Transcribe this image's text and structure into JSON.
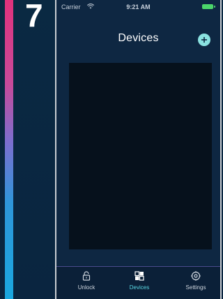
{
  "step": {
    "number": "7"
  },
  "status_bar": {
    "carrier": "Carrier",
    "time": "9:21 AM",
    "wifi_icon": "wifi-icon",
    "battery_icon": "battery-icon"
  },
  "nav": {
    "title": "Devices",
    "add_icon": "plus-icon"
  },
  "tabs": [
    {
      "label": "Unlock",
      "icon": "lock-icon",
      "active": false
    },
    {
      "label": "Devices",
      "icon": "grid-icon",
      "active": true
    },
    {
      "label": "Settings",
      "icon": "gear-icon",
      "active": false
    }
  ],
  "colors": {
    "accent_active": "#5ad8e3",
    "add_button": "#8ae2e0",
    "battery": "#4bd66b",
    "background": "#0e2742",
    "panel": "#06111c"
  }
}
